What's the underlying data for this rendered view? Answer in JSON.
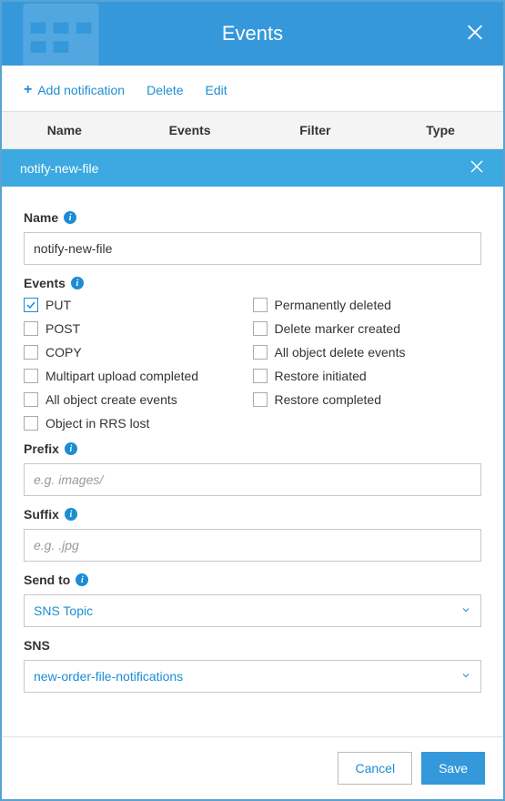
{
  "header": {
    "title": "Events"
  },
  "toolbar": {
    "add_label": "Add notification",
    "delete_label": "Delete",
    "edit_label": "Edit"
  },
  "table": {
    "headers": {
      "name": "Name",
      "events": "Events",
      "filter": "Filter",
      "type": "Type"
    }
  },
  "row": {
    "title": "notify-new-file"
  },
  "form": {
    "name": {
      "label": "Name",
      "value": "notify-new-file"
    },
    "events": {
      "label": "Events",
      "left": [
        {
          "label": "PUT",
          "checked": true
        },
        {
          "label": "POST",
          "checked": false
        },
        {
          "label": "COPY",
          "checked": false
        },
        {
          "label": "Multipart upload completed",
          "checked": false
        },
        {
          "label": "All object create events",
          "checked": false
        },
        {
          "label": "Object in RRS lost",
          "checked": false
        }
      ],
      "right": [
        {
          "label": "Permanently deleted",
          "checked": false
        },
        {
          "label": "Delete marker created",
          "checked": false
        },
        {
          "label": "All object delete events",
          "checked": false
        },
        {
          "label": "Restore initiated",
          "checked": false
        },
        {
          "label": "Restore completed",
          "checked": false
        }
      ]
    },
    "prefix": {
      "label": "Prefix",
      "placeholder": "e.g. images/",
      "value": ""
    },
    "suffix": {
      "label": "Suffix",
      "placeholder": "e.g. .jpg",
      "value": ""
    },
    "send_to": {
      "label": "Send to",
      "value": "SNS Topic"
    },
    "sns": {
      "label": "SNS",
      "value": "new-order-file-notifications"
    }
  },
  "footer": {
    "cancel": "Cancel",
    "save": "Save"
  }
}
